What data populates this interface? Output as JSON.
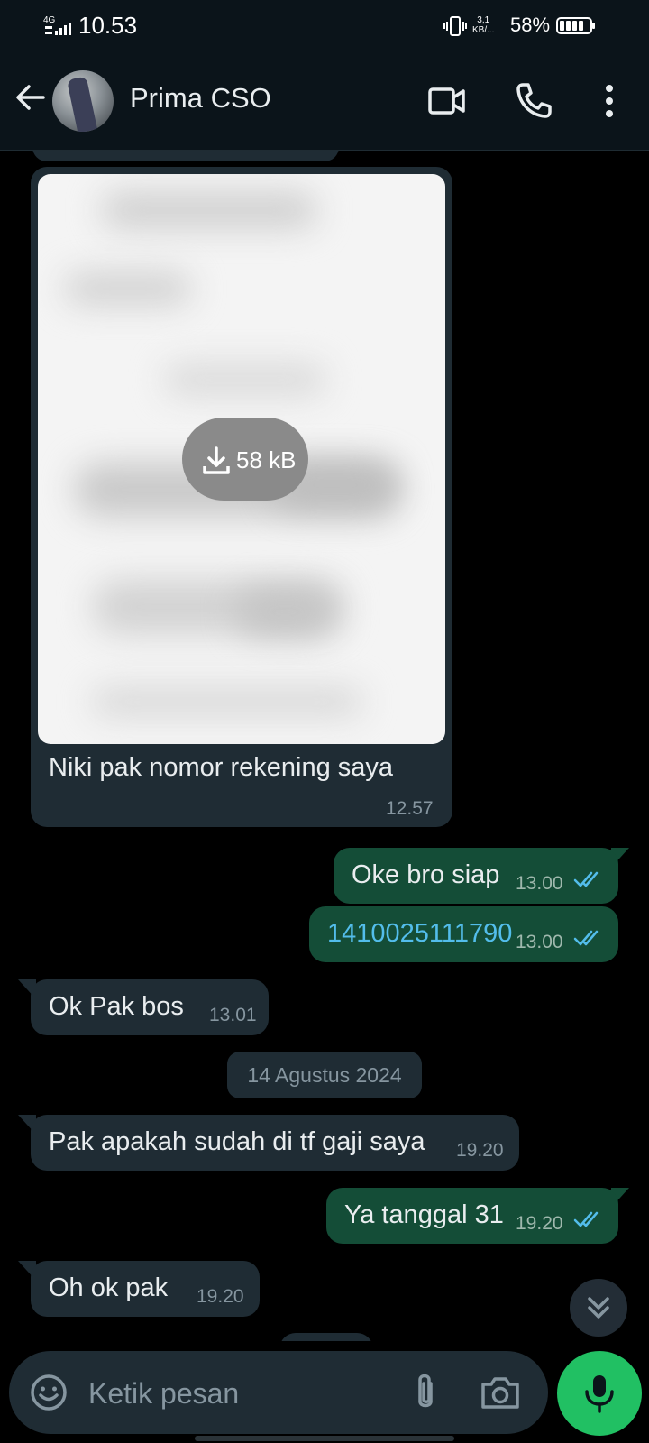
{
  "status_bar": {
    "network": "4G",
    "time": "10.53",
    "speed_value": "3,1",
    "speed_unit": "KB/...",
    "battery_percent": "58%"
  },
  "header": {
    "contact_name": "Prima CSO",
    "icons": [
      "back-arrow-icon",
      "video-call-icon",
      "phone-icon",
      "more-vertical-icon"
    ]
  },
  "messages": [
    {
      "direction": "in",
      "type": "image",
      "download_size": "58 kB",
      "caption": "Niki pak nomor rekening saya",
      "time": "12.57"
    },
    {
      "direction": "out",
      "text": "Oke bro siap",
      "time": "13.00",
      "status": "read"
    },
    {
      "direction": "out",
      "text": "1410025111790",
      "time": "13.00",
      "status": "read",
      "link_color": "#53bdeb"
    },
    {
      "direction": "in",
      "text": "Ok Pak bos",
      "time": "13.01"
    },
    {
      "date_divider": "14 Agustus 2024"
    },
    {
      "direction": "in",
      "text": "Pak apakah sudah di tf gaji saya",
      "time": "19.20"
    },
    {
      "direction": "out",
      "text": "Ya tanggal 31",
      "time": "19.20",
      "status": "read"
    },
    {
      "direction": "in",
      "text": "Oh ok pak",
      "time": "19.20"
    }
  ],
  "composer": {
    "placeholder": "Ketik pesan"
  },
  "colors": {
    "accent": "#21c063",
    "incoming_bubble": "#1f2c34",
    "outgoing_bubble": "#144d37",
    "read_ticks": "#53bdeb"
  }
}
